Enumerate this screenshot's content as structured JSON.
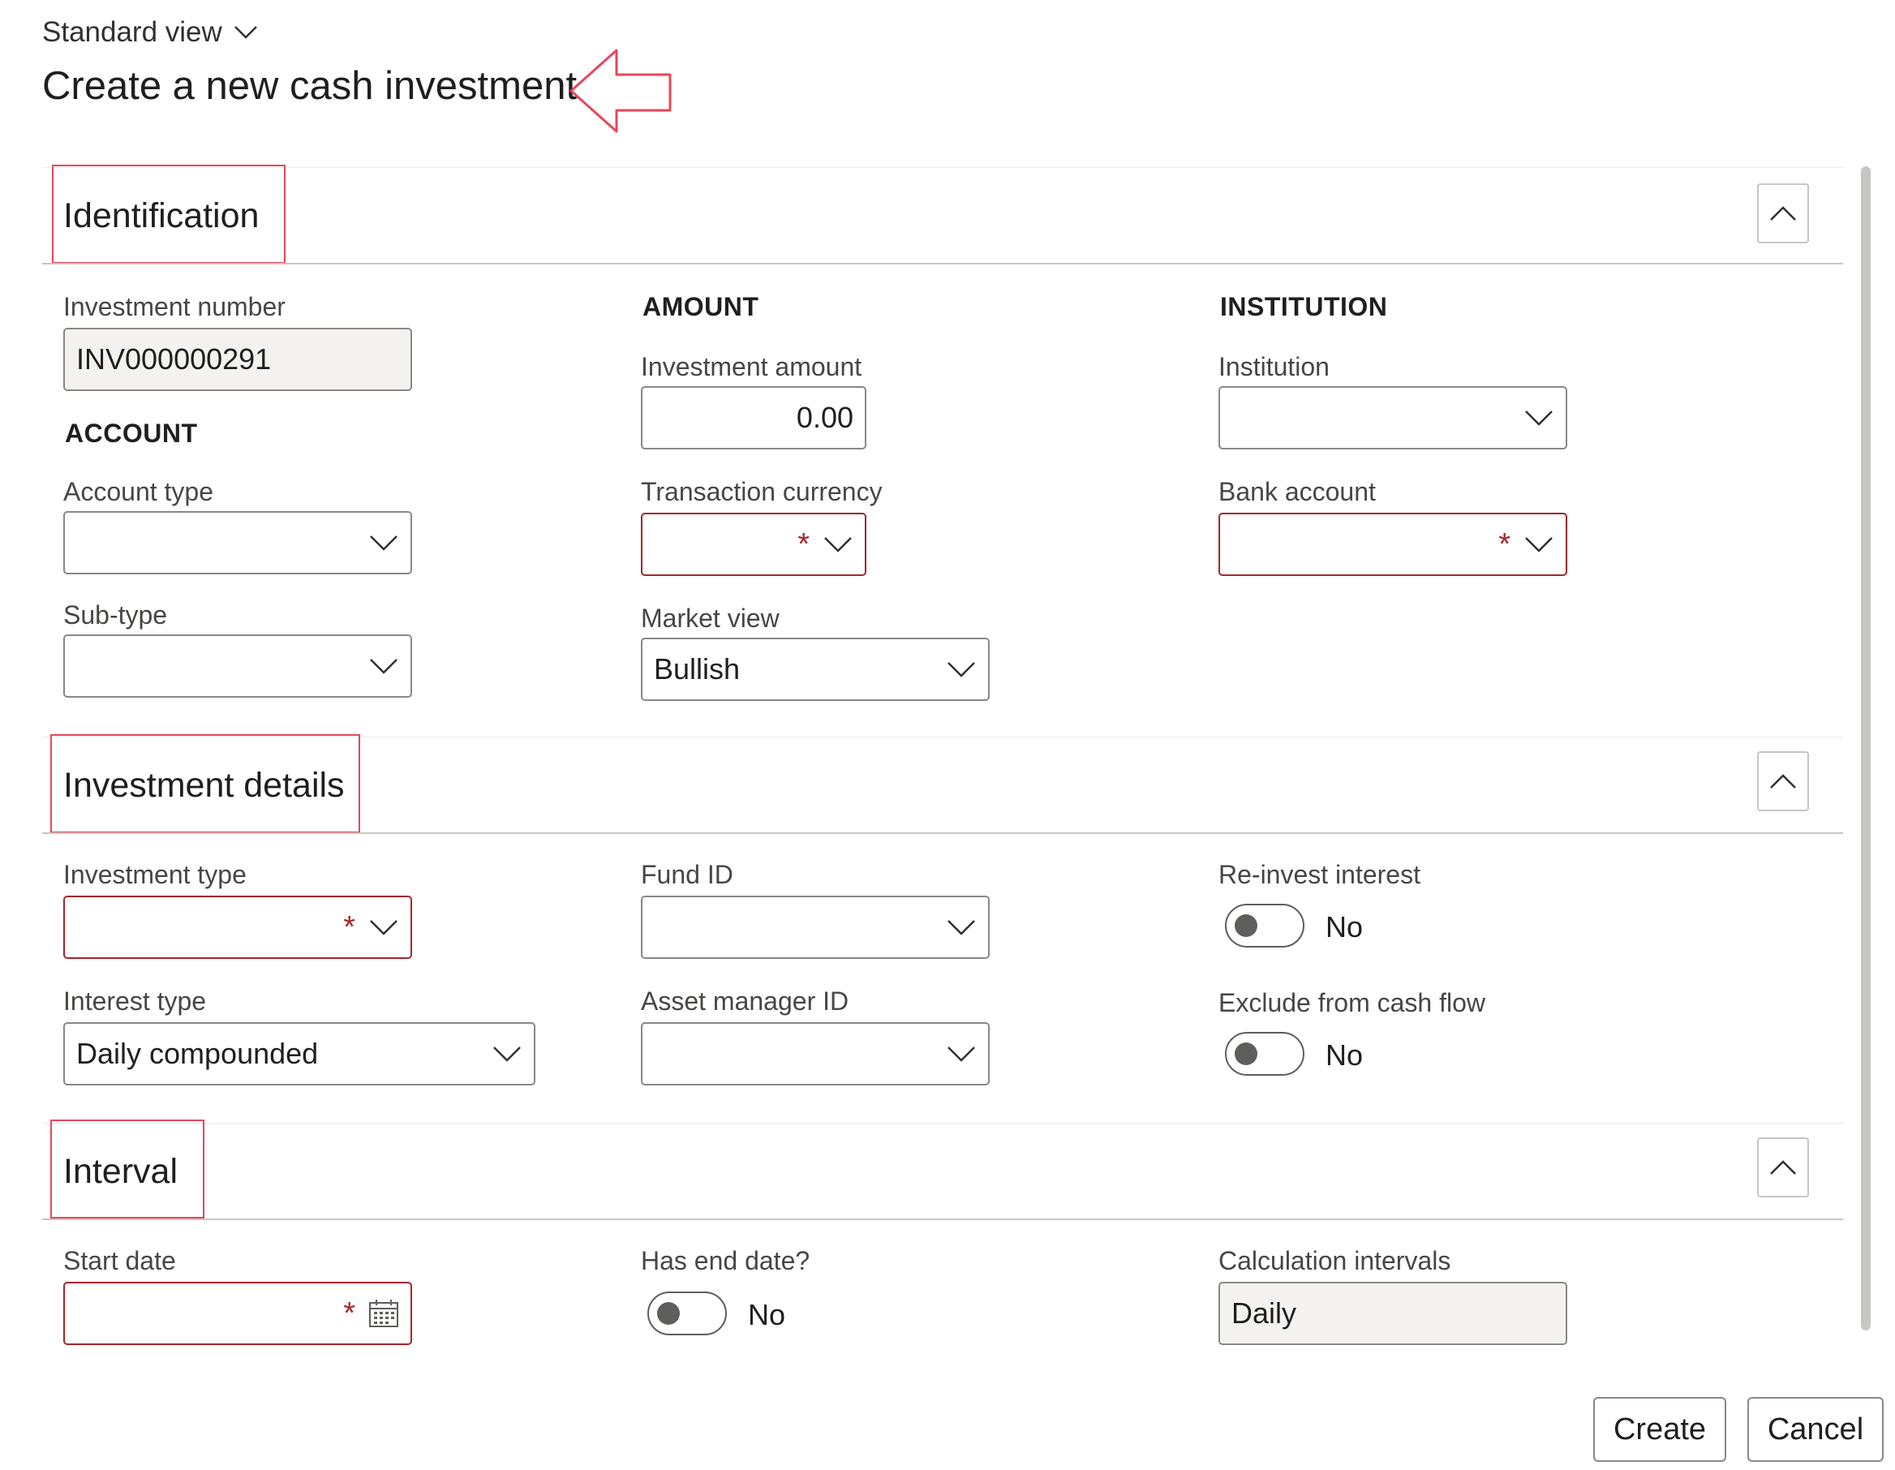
{
  "header": {
    "view_label": "Standard view",
    "title": "Create a new cash investment"
  },
  "identification": {
    "title": "Identification",
    "investment_number_label": "Investment number",
    "investment_number_value": "INV000000291",
    "account_group": "ACCOUNT",
    "account_type_label": "Account type",
    "account_type_value": "",
    "sub_type_label": "Sub-type",
    "sub_type_value": "",
    "amount_group": "AMOUNT",
    "investment_amount_label": "Investment amount",
    "investment_amount_value": "0.00",
    "transaction_currency_label": "Transaction currency",
    "transaction_currency_value": "",
    "market_view_label": "Market view",
    "market_view_value": "Bullish",
    "institution_group": "INSTITUTION",
    "institution_label": "Institution",
    "institution_value": "",
    "bank_account_label": "Bank account",
    "bank_account_value": ""
  },
  "investment_details": {
    "title": "Investment details",
    "investment_type_label": "Investment type",
    "investment_type_value": "",
    "interest_type_label": "Interest type",
    "interest_type_value": "Daily compounded",
    "fund_id_label": "Fund ID",
    "fund_id_value": "",
    "asset_manager_label": "Asset manager ID",
    "asset_manager_value": "",
    "reinvest_label": "Re-invest interest",
    "reinvest_value": "No",
    "exclude_label": "Exclude from cash flow",
    "exclude_value": "No"
  },
  "interval": {
    "title": "Interval",
    "start_date_label": "Start date",
    "start_date_value": "",
    "has_end_date_label": "Has end date?",
    "has_end_date_value": "No",
    "calc_intervals_label": "Calculation intervals",
    "calc_intervals_value": "Daily"
  },
  "required_marker": "*",
  "actions": {
    "create_label": "Create",
    "cancel_label": "Cancel"
  },
  "colors": {
    "required_border": "#a4262c",
    "annotation": "#e8465a"
  }
}
